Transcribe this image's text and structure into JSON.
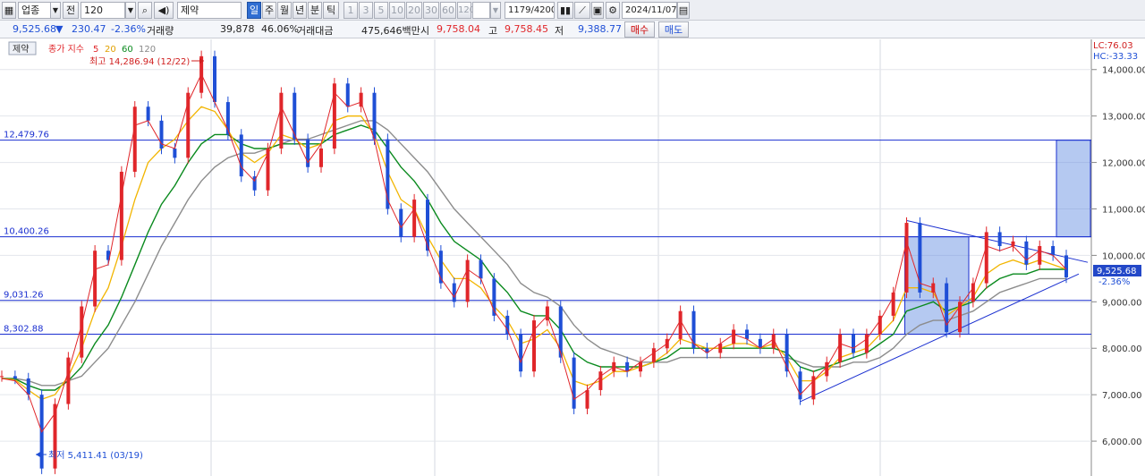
{
  "toolbar": {
    "market_select": "업종",
    "prev_button": "전",
    "period_input": "120",
    "sector_input": "제약",
    "period_tabs": [
      "일",
      "주",
      "월",
      "년",
      "분",
      "틱"
    ],
    "selected_tab": "일",
    "interval_buttons": [
      "1",
      "3",
      "5",
      "10",
      "20",
      "30",
      "60",
      "120"
    ],
    "count_display": "1179/4200",
    "date_input": "2024/11/07"
  },
  "infobar": {
    "price": "9,525.68",
    "change_arrow": "▼",
    "change": "230.47",
    "change_pct": "-2.36%",
    "volume_label": "거래량",
    "volume": "39,878",
    "volume_pct": "46.06%",
    "amount_label": "거래대금",
    "amount": "475,646백만",
    "open_label": "시",
    "open": "9,758.04",
    "high_label": "고",
    "high": "9,758.45",
    "low_label": "저",
    "low": "9,388.77",
    "buy_button": "매수",
    "sell_button": "매도"
  },
  "legend": {
    "tag": "제약",
    "index_label": "종가 지수",
    "ma": [
      "5",
      "20",
      "60",
      "120"
    ],
    "ma_colors": [
      "#e0262a",
      "#f2b500",
      "#0a8a1e",
      "#888888"
    ]
  },
  "annotations": {
    "high_marker": "최고 14,286.94 (12/22)",
    "low_marker": "최저 5,411.41 (03/19)",
    "lc": "LC:76.03",
    "hc": "HC:-33.33",
    "current_price": "9,525.68",
    "current_pct": "-2.36%"
  },
  "horizontal_lines": [
    {
      "label": "12,479.76",
      "value": 12479.76
    },
    {
      "label": "10,400.26",
      "value": 10400.26
    },
    {
      "label": "9,031.26",
      "value": 9031.26
    },
    {
      "label": "8,302.88",
      "value": 8302.88
    }
  ],
  "chart_data": {
    "type": "line",
    "yticks": [
      {
        "label": "14,000.00",
        "value": 14000
      },
      {
        "label": "13,000.00",
        "value": 13000
      },
      {
        "label": "12,000.00",
        "value": 12000
      },
      {
        "label": "11,000.00",
        "value": 11000
      },
      {
        "label": "10,000.00",
        "value": 10000
      },
      {
        "label": "9,000.00",
        "value": 9000
      },
      {
        "label": "8,000.00",
        "value": 8000
      },
      {
        "label": "7,000.00",
        "value": 7000
      },
      {
        "label": "6,000.00",
        "value": 6000
      }
    ],
    "ylim": [
      5250,
      14650
    ],
    "series_close": [
      7400,
      7350,
      7000,
      5411,
      6800,
      7800,
      8900,
      10100,
      9900,
      11800,
      13200,
      12900,
      12300,
      12100,
      13500,
      14287,
      13300,
      12600,
      11700,
      11400,
      12300,
      13500,
      12500,
      11900,
      12300,
      13700,
      13200,
      13500,
      12500,
      11000,
      10400,
      11200,
      10100,
      9400,
      9000,
      9900,
      9500,
      8700,
      8300,
      7500,
      8600,
      8900,
      7800,
      6700,
      7100,
      7500,
      7700,
      7500,
      7700,
      8000,
      8200,
      8800,
      8000,
      7900,
      8100,
      8400,
      8200,
      8000,
      8300,
      7500,
      6900,
      7400,
      7700,
      8300,
      7900,
      8300,
      8700,
      9200,
      10700,
      9200,
      9400,
      8350,
      9000,
      9400,
      10500,
      10200,
      10300,
      9800,
      10200,
      10000,
      9526
    ],
    "ma5": [
      7350,
      7300,
      7000,
      6200,
      6600,
      7500,
      8500,
      9700,
      9800,
      11300,
      12800,
      12900,
      12400,
      12300,
      13300,
      13900,
      13300,
      12700,
      11900,
      11600,
      12200,
      13200,
      12600,
      12000,
      12400,
      13500,
      13200,
      13300,
      12500,
      11200,
      10600,
      11000,
      10200,
      9500,
      9100,
      9700,
      9500,
      8800,
      8400,
      7700,
      8400,
      8700,
      7900,
      6900,
      7100,
      7400,
      7600,
      7500,
      7700,
      7900,
      8100,
      8600,
      8100,
      7900,
      8100,
      8300,
      8200,
      8000,
      8200,
      7600,
      7000,
      7300,
      7600,
      8100,
      8000,
      8200,
      8600,
      9100,
      10300,
      9400,
      9300,
      8500,
      8900,
      9300,
      10200,
      10100,
      10200,
      9900,
      10100,
      10000,
      9700
    ],
    "ma20": [
      7350,
      7320,
      7100,
      6900,
      7000,
      7400,
      8000,
      8800,
      9300,
      10200,
      11200,
      12000,
      12300,
      12500,
      12900,
      13200,
      13100,
      12700,
      12200,
      12000,
      12200,
      12600,
      12500,
      12300,
      12400,
      12900,
      13000,
      13000,
      12600,
      11800,
      11200,
      11000,
      10400,
      9900,
      9500,
      9500,
      9300,
      8900,
      8600,
      8100,
      8200,
      8400,
      8000,
      7300,
      7200,
      7300,
      7500,
      7500,
      7600,
      7700,
      7900,
      8200,
      8100,
      8000,
      8000,
      8100,
      8100,
      8000,
      8100,
      7800,
      7300,
      7300,
      7500,
      7800,
      7900,
      8000,
      8300,
      8600,
      9300,
      9300,
      9200,
      8700,
      8900,
      9100,
      9600,
      9800,
      9900,
      9800,
      9900,
      9800,
      9700
    ],
    "ma60": [
      7350,
      7340,
      7200,
      7100,
      7100,
      7300,
      7600,
      8100,
      8500,
      9100,
      9800,
      10500,
      11100,
      11500,
      12000,
      12400,
      12600,
      12600,
      12400,
      12300,
      12300,
      12400,
      12400,
      12400,
      12400,
      12600,
      12700,
      12800,
      12700,
      12300,
      11900,
      11600,
      11200,
      10700,
      10300,
      10100,
      9900,
      9500,
      9200,
      8800,
      8700,
      8700,
      8400,
      7900,
      7700,
      7600,
      7600,
      7600,
      7600,
      7700,
      7800,
      8000,
      8000,
      8000,
      8000,
      8000,
      8000,
      8000,
      8000,
      7900,
      7600,
      7500,
      7600,
      7700,
      7800,
      7900,
      8100,
      8300,
      8800,
      8900,
      9000,
      8800,
      8900,
      9000,
      9300,
      9500,
      9600,
      9600,
      9700,
      9700,
      9700
    ],
    "ma120": [
      7350,
      7350,
      7300,
      7200,
      7200,
      7300,
      7400,
      7700,
      8000,
      8500,
      9000,
      9600,
      10200,
      10700,
      11200,
      11600,
      11900,
      12100,
      12200,
      12200,
      12300,
      12400,
      12500,
      12500,
      12600,
      12700,
      12800,
      12900,
      12900,
      12700,
      12400,
      12100,
      11800,
      11400,
      11000,
      10700,
      10400,
      10100,
      9800,
      9400,
      9200,
      9100,
      8900,
      8500,
      8200,
      8000,
      7900,
      7800,
      7700,
      7700,
      7700,
      7800,
      7800,
      7800,
      7800,
      7800,
      7800,
      7800,
      7800,
      7800,
      7700,
      7600,
      7600,
      7600,
      7700,
      7700,
      7800,
      8000,
      8300,
      8500,
      8600,
      8600,
      8700,
      8800,
      9000,
      9200,
      9300,
      9400,
      9500,
      9500,
      9500
    ]
  }
}
